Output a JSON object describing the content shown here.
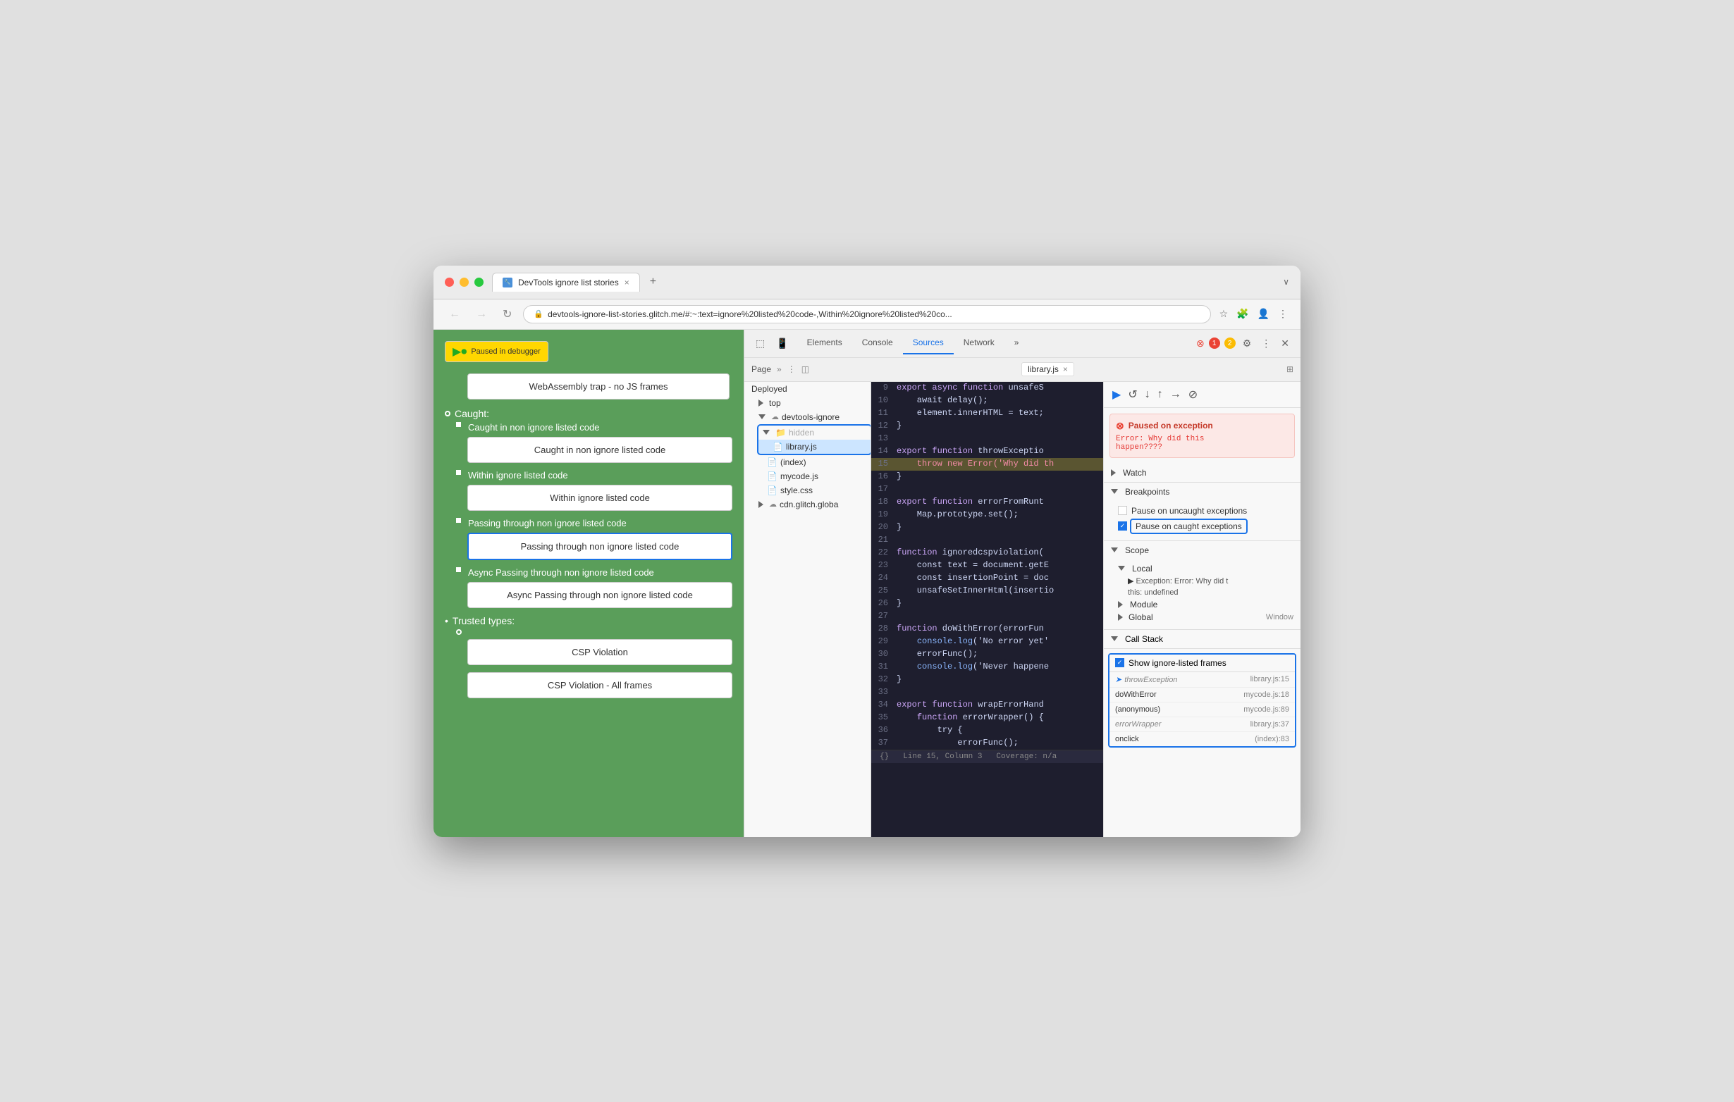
{
  "browser": {
    "title": "DevTools ignore list stories",
    "tab_favicon": "🔧",
    "tab_close": "×",
    "new_tab": "+",
    "overflow": "∨",
    "url": "devtools-ignore-list-stories.glitch.me/#:~:text=ignore%20listed%20code-,Within%20ignore%20listed%20co...",
    "nav": {
      "back": "←",
      "forward": "→",
      "reload": "↻"
    }
  },
  "left_panel": {
    "paused_badge": "Paused in debugger",
    "wasm_box": "WebAssembly trap - no JS frames",
    "caught_label": "Caught:",
    "items": [
      {
        "label": "Caught in non ignore listed code",
        "box": "Caught in non ignore listed code",
        "selected": false
      },
      {
        "label": "Within ignore listed code",
        "box": "Within ignore listed code",
        "selected": false
      },
      {
        "label": "Passing through non ignore listed code",
        "box": "Passing through non ignore listed code",
        "selected": true
      },
      {
        "label": "Async Passing through non ignore listed code",
        "box": "Async Passing through non ignore listed code",
        "selected": false
      }
    ],
    "trusted_label": "Trusted types:",
    "trusted_items": [
      "CSP Violation",
      "CSP Violation - All frames"
    ]
  },
  "devtools": {
    "tabs": [
      "Elements",
      "Console",
      "Sources",
      "Network"
    ],
    "active_tab": "Sources",
    "more_tabs": "»",
    "error_count": "1",
    "warning_count": "2",
    "file": {
      "name": "library.js",
      "close": "×"
    },
    "page_btn": "Page",
    "page_more": "»"
  },
  "file_tree": {
    "deployed_label": "Deployed",
    "top_label": "top",
    "devtools_ignore_label": "devtools-ignore",
    "hidden_folder": "hidden",
    "library_file": "library.js",
    "index_file": "(index)",
    "mycode_file": "mycode.js",
    "style_file": "style.css",
    "cdn_label": "cdn.glitch.globa"
  },
  "code": {
    "lines": [
      {
        "num": 9,
        "content": "export async function unsafeS",
        "type": "normal"
      },
      {
        "num": 10,
        "content": "    await delay();",
        "type": "normal"
      },
      {
        "num": 11,
        "content": "    element.innerHTML = text;",
        "type": "normal"
      },
      {
        "num": 12,
        "content": "}",
        "type": "normal"
      },
      {
        "num": 13,
        "content": "",
        "type": "normal"
      },
      {
        "num": 14,
        "content": "export function throwExceptio",
        "type": "normal"
      },
      {
        "num": 15,
        "content": "    throw new Error('Why did th",
        "type": "highlighted"
      },
      {
        "num": 16,
        "content": "}",
        "type": "normal"
      },
      {
        "num": 17,
        "content": "",
        "type": "normal"
      },
      {
        "num": 18,
        "content": "export function errorFromRunt",
        "type": "normal"
      },
      {
        "num": 19,
        "content": "    Map.prototype.set();",
        "type": "normal"
      },
      {
        "num": 20,
        "content": "}",
        "type": "normal"
      },
      {
        "num": 21,
        "content": "",
        "type": "normal"
      },
      {
        "num": 22,
        "content": "function ignoredcspviolation(",
        "type": "normal"
      },
      {
        "num": 23,
        "content": "    const text = document.getE",
        "type": "normal"
      },
      {
        "num": 24,
        "content": "    const insertionPoint = doc",
        "type": "normal"
      },
      {
        "num": 25,
        "content": "    unsafeSetInnerHtml(insertio",
        "type": "normal"
      },
      {
        "num": 26,
        "content": "}",
        "type": "normal"
      },
      {
        "num": 27,
        "content": "",
        "type": "normal"
      },
      {
        "num": 28,
        "content": "function doWithError(errorFun",
        "type": "normal"
      },
      {
        "num": 29,
        "content": "    console.log('No error yet'",
        "type": "normal"
      },
      {
        "num": 30,
        "content": "    errorFunc();",
        "type": "normal"
      },
      {
        "num": 31,
        "content": "    console.log('Never happene",
        "type": "normal"
      },
      {
        "num": 32,
        "content": "}",
        "type": "normal"
      },
      {
        "num": 33,
        "content": "",
        "type": "normal"
      },
      {
        "num": 34,
        "content": "export function wrapErrorHand",
        "type": "normal"
      },
      {
        "num": 35,
        "content": "    function errorWrapper() {",
        "type": "normal"
      },
      {
        "num": 36,
        "content": "        try {",
        "type": "normal"
      },
      {
        "num": 37,
        "content": "            errorFunc();",
        "type": "normal"
      }
    ],
    "status_bar": {
      "line_col": "Line 15, Column 3",
      "coverage": "Coverage: n/a"
    }
  },
  "right_panel": {
    "exception": {
      "title": "Paused on exception",
      "message": "Error: Why did this\nhappen????"
    },
    "watch_label": "Watch",
    "breakpoints_label": "Breakpoints",
    "pause_uncaught": "Pause on uncaught exceptions",
    "pause_caught": "Pause on caught exceptions",
    "scope_label": "Scope",
    "local_label": "Local",
    "exception_local": "Exception: Error: Why did t",
    "this_val": "this: undefined",
    "module_label": "Module",
    "global_label": "Global",
    "global_val": "Window",
    "call_stack_label": "Call Stack",
    "show_ignore_label": "Show ignore-listed frames",
    "stack_frames": [
      {
        "fn": "throwException",
        "loc": "library.js:15",
        "ignored": true,
        "current": true,
        "arrow": true
      },
      {
        "fn": "doWithError",
        "loc": "mycode.js:18",
        "ignored": false
      },
      {
        "fn": "(anonymous)",
        "loc": "mycode.js:89",
        "ignored": false
      },
      {
        "fn": "errorWrapper",
        "loc": "library.js:37",
        "ignored": true
      },
      {
        "fn": "onclick",
        "loc": "(index):83",
        "ignored": false
      }
    ]
  }
}
